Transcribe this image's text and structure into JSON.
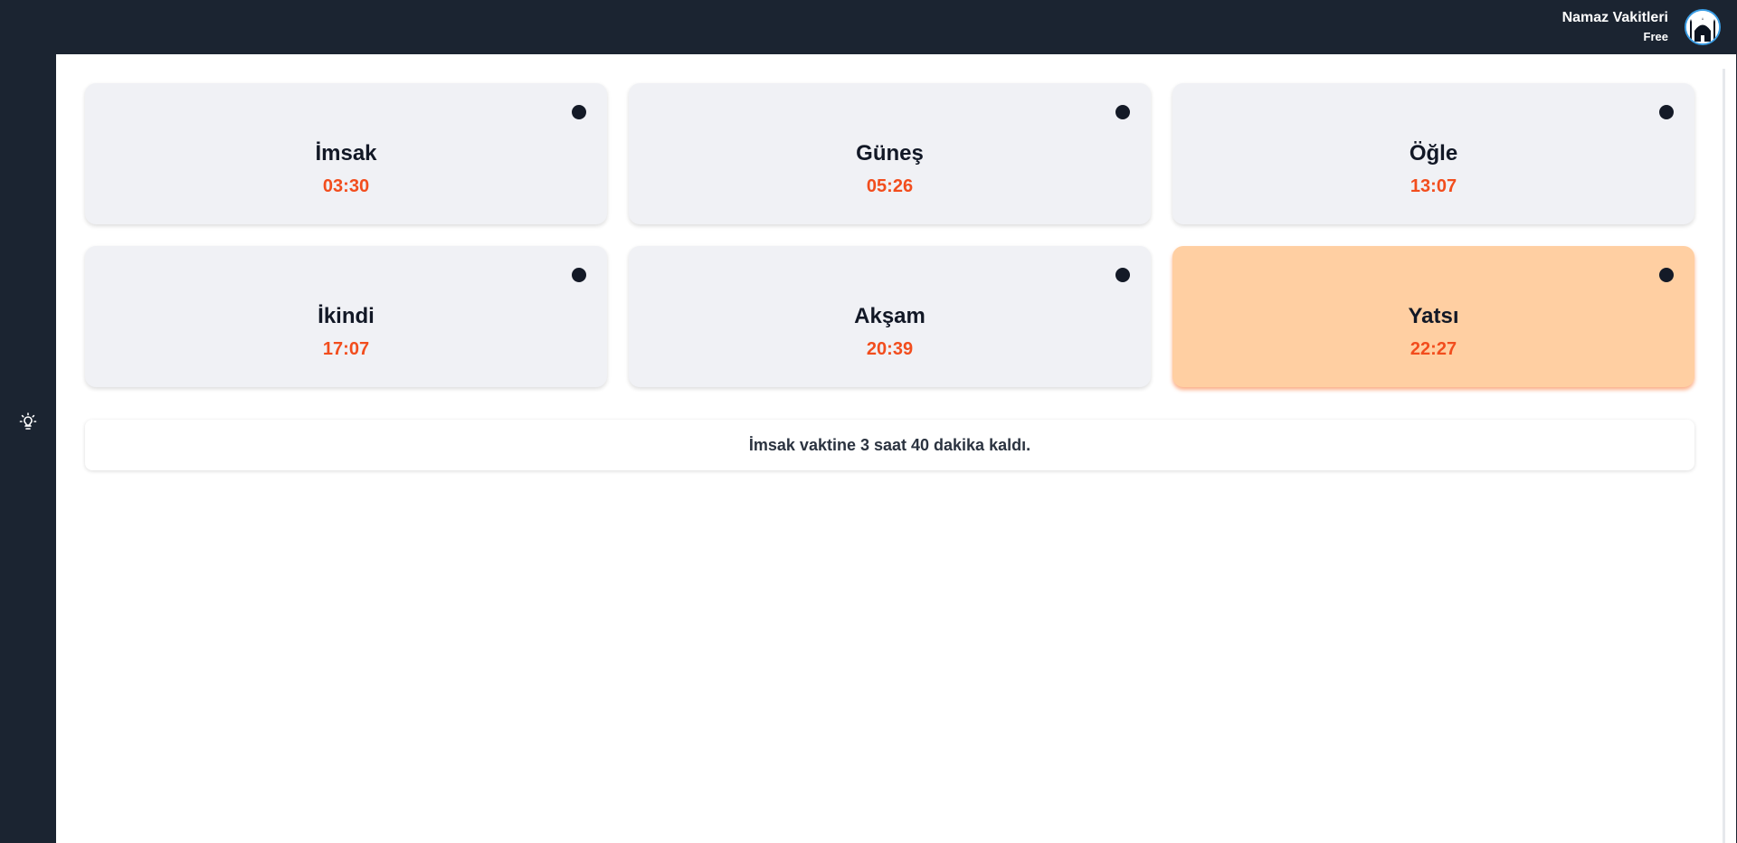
{
  "header": {
    "app_title": "Namaz Vakitleri",
    "plan": "Free",
    "avatar_icon": "mosque-icon"
  },
  "sidebar": {
    "theme_toggle_icon": "lightbulb-icon"
  },
  "prayers": [
    {
      "name": "İmsak",
      "time": "03:30",
      "active": false
    },
    {
      "name": "Güneş",
      "time": "05:26",
      "active": false
    },
    {
      "name": "Öğle",
      "time": "13:07",
      "active": false
    },
    {
      "name": "İkindi",
      "time": "17:07",
      "active": false
    },
    {
      "name": "Akşam",
      "time": "20:39",
      "active": false
    },
    {
      "name": "Yatsı",
      "time": "22:27",
      "active": true
    }
  ],
  "countdown": {
    "text": "İmsak vaktine 3 saat 40 dakika kaldı."
  },
  "colors": {
    "background_dark": "#1b2431",
    "card_bg": "#f0f1f5",
    "card_active_bg": "#ffcfa2",
    "time_color": "#f24d1d",
    "dot_color": "#141a27"
  }
}
